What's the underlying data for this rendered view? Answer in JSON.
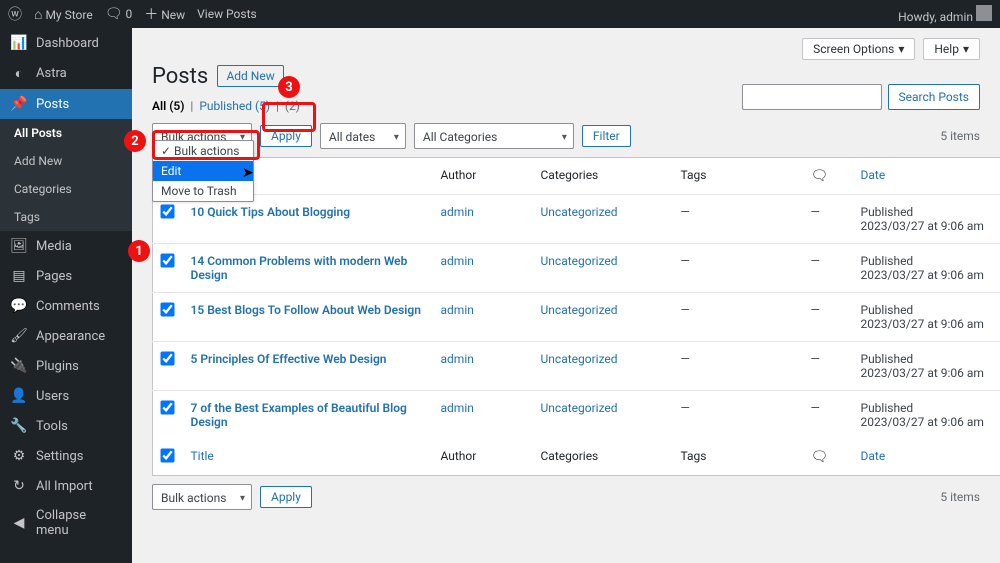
{
  "adminbar": {
    "site_name": "My Store",
    "comments_count": "0",
    "new_label": "New",
    "view_posts": "View Posts",
    "howdy": "Howdy, admin"
  },
  "sidebar": {
    "items": [
      {
        "icon": "📊",
        "label": "Dashboard"
      },
      {
        "icon": "◐",
        "label": "Astra"
      },
      {
        "icon": "📌",
        "label": "Posts",
        "current": true
      },
      {
        "label": "All Posts",
        "sub": true,
        "active": true
      },
      {
        "label": "Add New",
        "sub": true
      },
      {
        "label": "Categories",
        "sub": true
      },
      {
        "label": "Tags",
        "sub": true
      },
      {
        "icon": "🖼",
        "label": "Media"
      },
      {
        "icon": "▤",
        "label": "Pages"
      },
      {
        "icon": "💬",
        "label": "Comments"
      },
      {
        "icon": "🖌",
        "label": "Appearance"
      },
      {
        "icon": "🔌",
        "label": "Plugins"
      },
      {
        "icon": "👤",
        "label": "Users"
      },
      {
        "icon": "🔧",
        "label": "Tools"
      },
      {
        "icon": "⚙",
        "label": "Settings"
      },
      {
        "icon": "↻",
        "label": "All Import"
      },
      {
        "icon": "◀",
        "label": "Collapse menu"
      }
    ]
  },
  "page": {
    "title": "Posts",
    "add_new": "Add New",
    "screen_options": "Screen Options",
    "help": "Help"
  },
  "filters": {
    "subsubsub_all": "All",
    "all_count": "(5)",
    "published": "Published",
    "published_count": "(5)",
    "trash_count": "(2)",
    "bulk_label": "Bulk actions",
    "bulk_options": {
      "bulk": "Bulk actions",
      "edit": "Edit",
      "trash": "Move to Trash"
    },
    "apply": "Apply",
    "all_dates": "All dates",
    "all_categories": "All Categories",
    "filter": "Filter",
    "search_posts": "Search Posts",
    "items_count": "5 items",
    "bulk_bottom": "Bulk actions"
  },
  "table": {
    "cols": {
      "title": "Title",
      "author": "Author",
      "categories": "Categories",
      "tags": "Tags",
      "date": "Date"
    },
    "rows": [
      {
        "title": "10 Quick Tips About Blogging",
        "author": "admin",
        "cat": "Uncategorized",
        "tags": "—",
        "comments": "—",
        "date": "Published\n2023/03/27 at 9:06 am"
      },
      {
        "title": "14 Common Problems with modern Web Design",
        "author": "admin",
        "cat": "Uncategorized",
        "tags": "—",
        "comments": "—",
        "date": "Published\n2023/03/27 at 9:06 am"
      },
      {
        "title": "15 Best Blogs To Follow About Web Design",
        "author": "admin",
        "cat": "Uncategorized",
        "tags": "—",
        "comments": "—",
        "date": "Published\n2023/03/27 at 9:06 am"
      },
      {
        "title": "5 Principles Of Effective Web Design",
        "author": "admin",
        "cat": "Uncategorized",
        "tags": "—",
        "comments": "—",
        "date": "Published\n2023/03/27 at 9:06 am"
      },
      {
        "title": "7 of the Best Examples of Beautiful Blog Design",
        "author": "admin",
        "cat": "Uncategorized",
        "tags": "—",
        "comments": "—",
        "date": "Published\n2023/03/27 at 9:06 am"
      }
    ]
  },
  "annotations": {
    "c1": "1",
    "c2": "2",
    "c3": "3"
  }
}
